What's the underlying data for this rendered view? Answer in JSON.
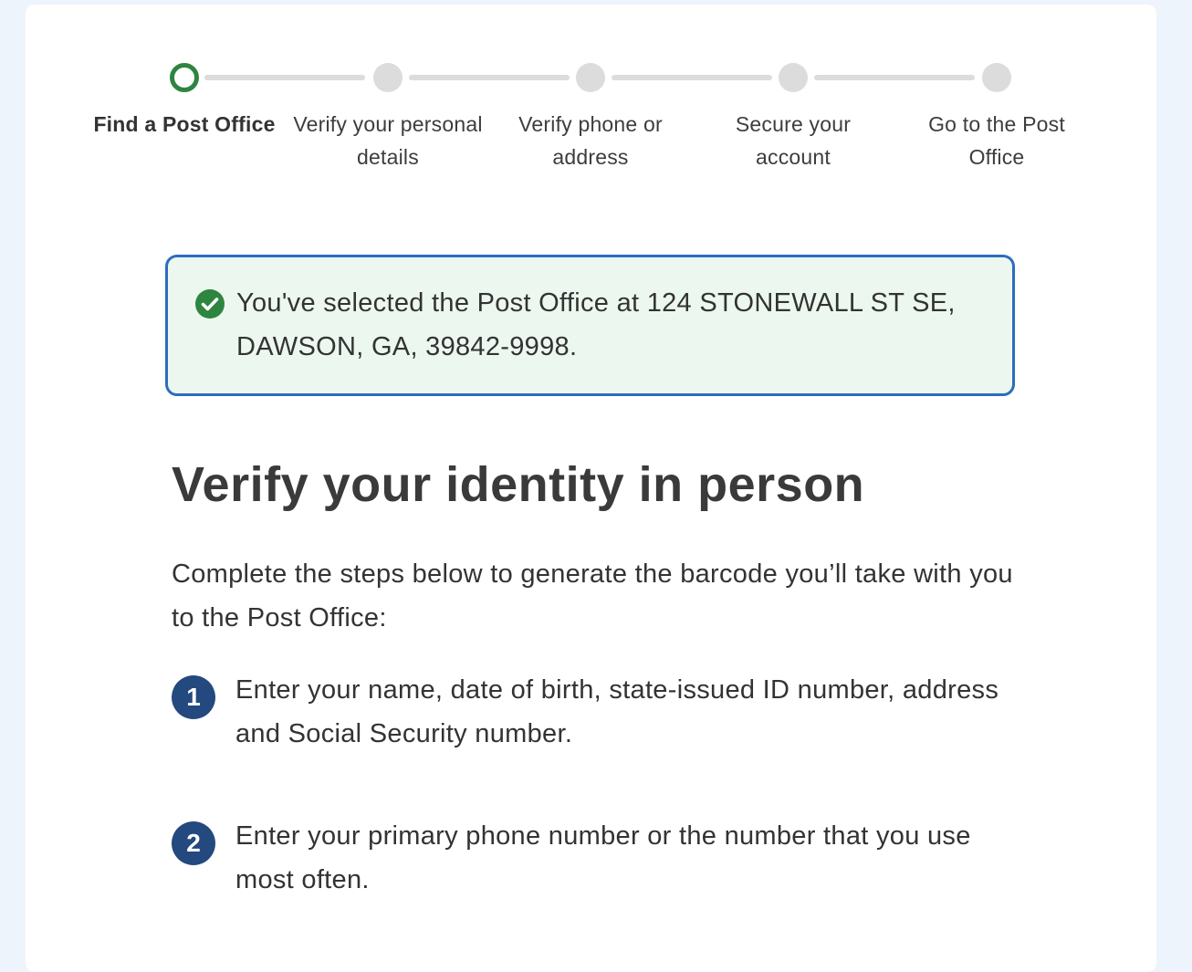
{
  "stepper": {
    "steps": [
      {
        "label": "Find a Post Office",
        "state": "current"
      },
      {
        "label": "Verify your personal details",
        "state": "upcoming"
      },
      {
        "label": "Verify phone or address",
        "state": "upcoming"
      },
      {
        "label": "Secure your account",
        "state": "upcoming"
      },
      {
        "label": "Go to the Post Office",
        "state": "upcoming"
      }
    ],
    "colors": {
      "current_ring": "#2e8540",
      "upcoming": "#dcdcdc"
    }
  },
  "alert": {
    "type": "success",
    "icon": "check-circle-icon",
    "text": "You've selected the Post Office at 124 STONEWALL ST SE, DAWSON, GA, 39842-9998.",
    "colors": {
      "background": "#ecf8ef",
      "border": "#2d6cc0",
      "icon": "#2e8540"
    }
  },
  "main": {
    "title": "Verify your identity in person",
    "intro": "Complete the steps below to generate the barcode you’ll take with you to the Post Office:",
    "process_steps": [
      {
        "number": "1",
        "text": "Enter your name, date of birth, state-issued ID number, address and Social Security number."
      },
      {
        "number": "2",
        "text": "Enter your primary phone number or the number that you use most often."
      }
    ],
    "colors": {
      "number_badge": "#24497e"
    }
  }
}
